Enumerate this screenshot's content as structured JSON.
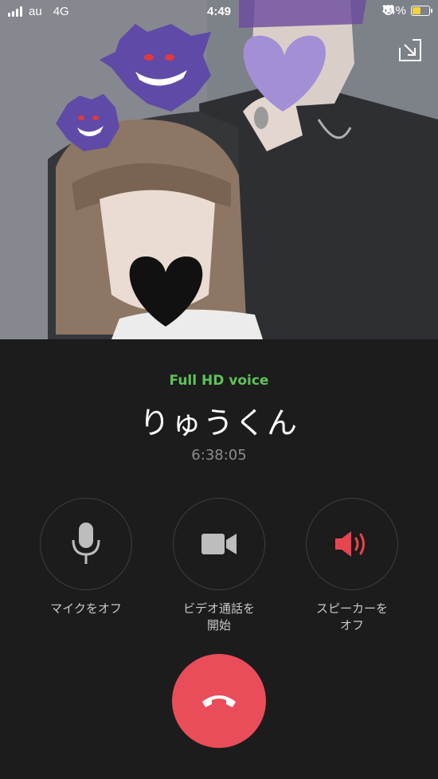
{
  "status_bar": {
    "carrier": "au",
    "network": "4G",
    "time": "4:49",
    "battery_percent": "44%",
    "battery_level": 0.44
  },
  "call": {
    "quality_label": "Full HD voice",
    "contact_name": "りゅうくん",
    "duration": "6:38:05"
  },
  "controls": {
    "mute_label": "マイクをオフ",
    "video_label_line1": "ビデオ通話を",
    "video_label_line2": "開始",
    "speaker_label_line1": "スピーカーを",
    "speaker_label_line2": "オフ"
  },
  "colors": {
    "accent_green": "#5fc35a",
    "end_call_red": "#ea4d5a",
    "speaker_red": "#e8444f",
    "panel_bg": "#1c1c1c"
  },
  "icons": {
    "minimize": "minimize-arrow-icon",
    "mic": "microphone-icon",
    "video": "video-camera-icon",
    "speaker": "speaker-icon",
    "end_call": "phone-hangup-icon"
  }
}
